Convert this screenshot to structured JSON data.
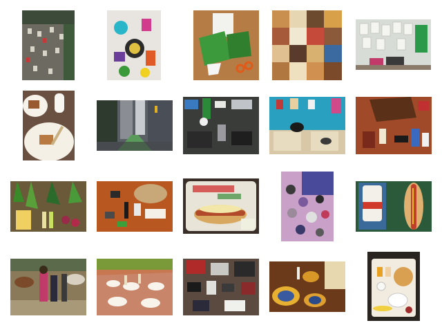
{
  "gallery": {
    "thumbnails": [
      {
        "subject": "aerial-parking-lot-photo"
      },
      {
        "subject": "colorful-craft-items-photo"
      },
      {
        "subject": "paper-cutting-scissors-photo"
      },
      {
        "subject": "food-photo-grid-collage"
      },
      {
        "subject": "room-wall-papers-laptop-photo"
      },
      {
        "subject": "pastries-on-plates-photo"
      },
      {
        "subject": "city-street-buildings-photo"
      },
      {
        "subject": "gadgets-on-desk-photo"
      },
      {
        "subject": "cat-on-blue-shelf-photo"
      },
      {
        "subject": "bag-contents-spread-photo"
      },
      {
        "subject": "vegetables-arrangement-photo"
      },
      {
        "subject": "items-spread-on-table-photo"
      },
      {
        "subject": "hot-dog-tray-photo"
      },
      {
        "subject": "yarn-balls-keyboard-photo"
      },
      {
        "subject": "hot-dog-cup-photo"
      },
      {
        "subject": "horses-and-people-photo"
      },
      {
        "subject": "dining-table-party-photo"
      },
      {
        "subject": "electronics-flat-lay-photo"
      },
      {
        "subject": "table-setting-plates-photo"
      },
      {
        "subject": "breakfast-tray-photo"
      }
    ]
  }
}
